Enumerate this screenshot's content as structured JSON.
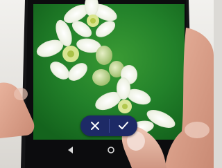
{
  "photo": {
    "subject": "white-flower-close-up",
    "colors": {
      "background": "#1f7a24",
      "petal": "#f4f6ec",
      "bud": "#c9dc9a"
    }
  },
  "overlay": {
    "cancel_icon": "close-icon",
    "confirm_icon": "check-icon",
    "pill_color": "#1d2a66"
  },
  "navbar": {
    "back_icon": "back-triangle-icon",
    "home_icon": "home-circle-icon"
  }
}
